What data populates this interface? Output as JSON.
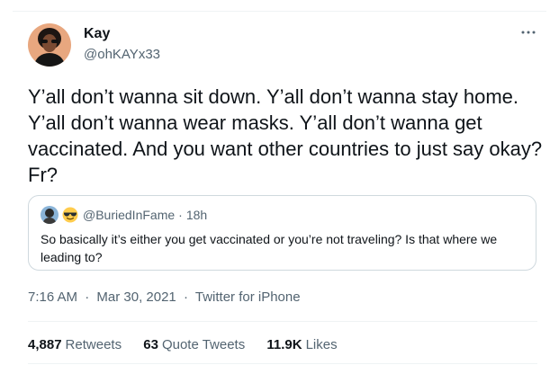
{
  "tweet": {
    "author": {
      "display_name": "Kay",
      "handle": "@ohKAYx33",
      "avatar_icon": "profile-photo"
    },
    "more_icon": "ellipsis-icon",
    "text": "Y’all don’t wanna sit down. Y’all don’t wanna stay home. Y’all don’t wanna wear masks. Y’all don’t wanna get vaccinated. And you want other countries to just say okay? Fr?",
    "quoted": {
      "emoji": "😎",
      "handle": "@BuriedInFame",
      "separator": "·",
      "age": "18h",
      "text": "So basically it’s either you get vaccinated or you’re not traveling? Is that where we leading to?"
    },
    "meta": {
      "time": "7:16 AM",
      "dot1": "·",
      "date": "Mar 30, 2021",
      "dot2": "·",
      "source": "Twitter for iPhone"
    },
    "stats": {
      "retweets_count": "4,887",
      "retweets_label": "Retweets",
      "quotes_count": "63",
      "quotes_label": "Quote Tweets",
      "likes_count": "11.9K",
      "likes_label": "Likes"
    }
  },
  "colors": {
    "text_primary": "#0f1419",
    "text_secondary": "#536471",
    "border": "#cfd9de",
    "divider": "#eff3f4"
  }
}
